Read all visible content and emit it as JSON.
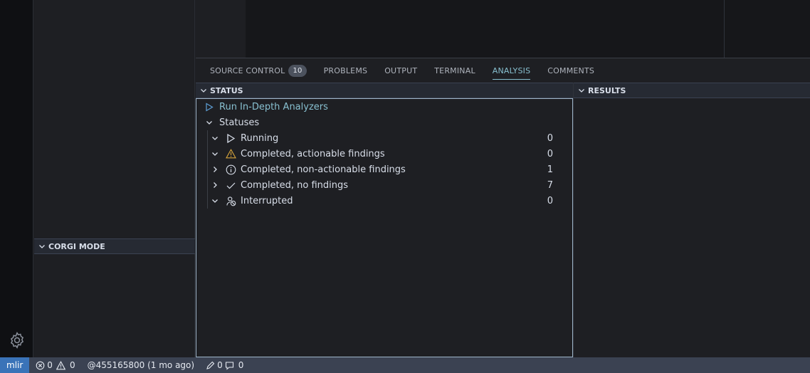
{
  "sidebar": {
    "corgi_header": "CORGI MODE"
  },
  "panel": {
    "tabs": [
      {
        "label": "SOURCE CONTROL",
        "badge": "10"
      },
      {
        "label": "PROBLEMS"
      },
      {
        "label": "OUTPUT"
      },
      {
        "label": "TERMINAL"
      },
      {
        "label": "ANALYSIS",
        "active": true
      },
      {
        "label": "COMMENTS"
      }
    ]
  },
  "status_section": {
    "header": "STATUS",
    "run_action": "Run In-Depth Analyzers",
    "group_label": "Statuses",
    "items": [
      {
        "label": "Running",
        "count": "0",
        "icon": "run-icon",
        "expanded": true
      },
      {
        "label": "Completed, actionable findings",
        "count": "0",
        "icon": "warning-icon",
        "expanded": true
      },
      {
        "label": "Completed, non-actionable findings",
        "count": "1",
        "icon": "info-icon",
        "expanded": false
      },
      {
        "label": "Completed, no findings",
        "count": "7",
        "icon": "check-icon",
        "expanded": false
      },
      {
        "label": "Interrupted",
        "count": "0",
        "icon": "interrupted-icon",
        "expanded": true
      }
    ]
  },
  "results_section": {
    "header": "RESULTS"
  },
  "statusbar": {
    "remote": "mlir",
    "errors": "0",
    "warnings": "0",
    "blame": "@455165800 (1 mo ago)",
    "edits": "0",
    "comments": "0"
  },
  "colors": {
    "accent": "#88c0d0",
    "remote_bg": "#3a73b8",
    "warning": "#d7a53b",
    "statusbar_bg": "#3b4252"
  }
}
